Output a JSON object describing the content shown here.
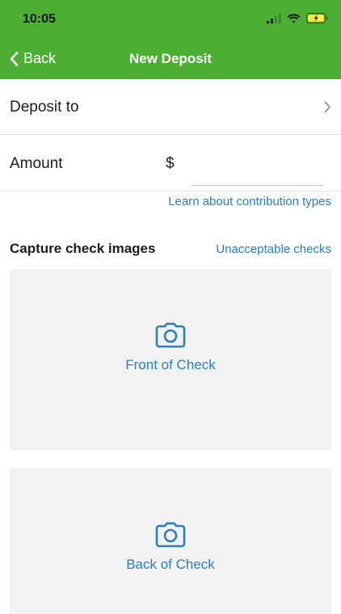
{
  "status_bar": {
    "time": "10:05",
    "icons": [
      "cellular-signal-icon",
      "wifi-icon",
      "battery-charging-icon"
    ]
  },
  "nav": {
    "back_label": "Back",
    "title": "New Deposit"
  },
  "form": {
    "deposit_to_label": "Deposit to",
    "amount_label": "Amount",
    "currency_symbol": "$",
    "amount_value": "",
    "amount_placeholder": "",
    "contribution_link": "Learn about contribution types"
  },
  "capture": {
    "section_title": "Capture check images",
    "unacceptable_link": "Unacceptable checks",
    "front_label": "Front of Check",
    "back_label": "Back of Check"
  },
  "colors": {
    "header_green": "#4caf33",
    "link_blue": "#2a7fc1",
    "tile_gray": "#f2f2f2"
  }
}
